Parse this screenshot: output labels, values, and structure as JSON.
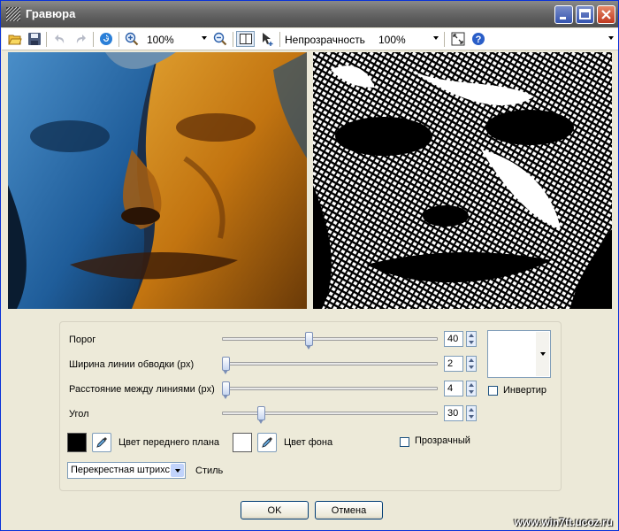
{
  "window": {
    "title": "Гравюра"
  },
  "toolbar": {
    "zoom": "100%",
    "opacity_label": "Непрозрачность",
    "opacity": "100%"
  },
  "controls": {
    "threshold": {
      "label": "Порог",
      "value": "40",
      "fraction": 0.4
    },
    "stroke_width": {
      "label": "Ширина линии обводки (px)",
      "value": "2",
      "fraction": 0.0
    },
    "line_spacing": {
      "label": "Расстояние между линиями (px)",
      "value": "4",
      "fraction": 0.0
    },
    "angle": {
      "label": "Угол",
      "value": "30",
      "fraction": 0.17
    },
    "invert_label": "Инвертир",
    "fg_color_label": "Цвет переднего плана",
    "bg_color_label": "Цвет фона",
    "transparent_label": "Прозрачный",
    "style_value": "Перекрестная штрихс",
    "style_label": "Стиль"
  },
  "colors": {
    "foreground": "#000000",
    "background": "#ffffff"
  },
  "buttons": {
    "ok": "OK",
    "cancel": "Отмена"
  },
  "watermark": "www.win7tt.ucoz.ru",
  "icons": [
    "open-icon",
    "save-icon",
    "undo-icon",
    "redo-icon",
    "reset-icon",
    "zoom-in-icon",
    "zoom-out-icon",
    "split-view-icon",
    "cursor-icon",
    "fit-icon",
    "help-icon"
  ]
}
